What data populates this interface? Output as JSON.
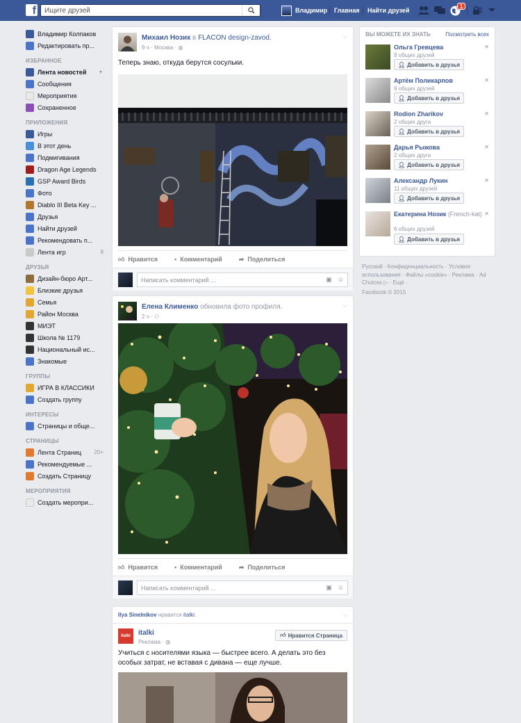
{
  "topbar": {
    "search_placeholder": "Ищите друзей",
    "user_name": "Владимир",
    "home": "Главная",
    "find_friends": "Найти друзей",
    "notifications_count": "1"
  },
  "sidebar": {
    "profile": [
      {
        "label": "Владимир Колпаков",
        "icon": "avatar",
        "color": "#3b5998"
      },
      {
        "label": "Редактировать пр...",
        "icon": "pencil-icon",
        "color": "#4a73c9"
      }
    ],
    "favorites_header": "ИЗБРАННОЕ",
    "favorites": [
      {
        "label": "Лента новостей",
        "icon": "news-feed-icon",
        "color": "#3b5998"
      },
      {
        "label": "Сообщения",
        "icon": "messages-icon",
        "color": "#4a73c9"
      },
      {
        "label": "Мероприятия",
        "icon": "calendar-icon",
        "color": "#e9e9e9"
      },
      {
        "label": "Сохраненное",
        "icon": "bookmark-icon",
        "color": "#8b4fb8"
      }
    ],
    "apps_header": "ПРИЛОЖЕНИЯ",
    "apps": [
      {
        "label": "Игры",
        "icon": "games-icon",
        "color": "#3b5998"
      },
      {
        "label": "В этот день",
        "icon": "clock-icon",
        "color": "#4a90d9"
      },
      {
        "label": "Подмигивания",
        "icon": "poke-icon",
        "color": "#4a73c9"
      },
      {
        "label": "Dragon Age Legends",
        "icon": "dragon-age-icon",
        "color": "#a11c1c"
      },
      {
        "label": "GSP Award Birds",
        "icon": "gsp-birds-icon",
        "color": "#2a6fb2"
      },
      {
        "label": "Фото",
        "icon": "photos-icon",
        "color": "#4a73c9"
      },
      {
        "label": "Diablo III Beta Key ...",
        "icon": "diablo-icon",
        "color": "#b0762c"
      },
      {
        "label": "Друзья",
        "icon": "friends-icon",
        "color": "#4a73c9"
      },
      {
        "label": "Найти друзей",
        "icon": "find-friends-icon",
        "color": "#4a73c9"
      },
      {
        "label": "Рекомендовать п...",
        "icon": "suggest-icon",
        "color": "#4a73c9"
      },
      {
        "label": "Лента игр",
        "icon": "game-feed-icon",
        "color": "#c9c9c9",
        "count": "8"
      }
    ],
    "friends_header": "ДРУЗЬЯ",
    "friends": [
      {
        "label": "Дизайн-бюро Арт...",
        "icon": "briefcase-icon",
        "color": "#8a6d3b"
      },
      {
        "label": "Близкие друзья",
        "icon": "star-icon",
        "color": "#f5c33b"
      },
      {
        "label": "Семья",
        "icon": "home-icon",
        "color": "#e0a82e"
      },
      {
        "label": "Район Москва",
        "icon": "home-icon",
        "color": "#e0a82e"
      },
      {
        "label": "МИЭТ",
        "icon": "graduation-icon",
        "color": "#333333"
      },
      {
        "label": "Школа № 1179",
        "icon": "graduation-icon",
        "color": "#333333"
      },
      {
        "label": "Национальный ис...",
        "icon": "graduation-icon",
        "color": "#333333"
      },
      {
        "label": "Знакомые",
        "icon": "acquaintances-icon",
        "color": "#4a73c9"
      }
    ],
    "groups_header": "ГРУППЫ",
    "groups": [
      {
        "label": "ИГРА В КЛАССИКИ",
        "icon": "group-house-icon",
        "color": "#e0a82e"
      },
      {
        "label": "Создать группу",
        "icon": "plus-icon",
        "color": "#4a73c9"
      }
    ],
    "interests_header": "ИНТЕРЕСЫ",
    "interests": [
      {
        "label": "Страницы и обще...",
        "icon": "pages-list-icon",
        "color": "#4a73c9"
      }
    ],
    "pages_header": "СТРАНИЦЫ",
    "pages": [
      {
        "label": "Лента Страниц",
        "icon": "flag-icon",
        "color": "#e07a2e",
        "count": "20+"
      },
      {
        "label": "Рекомендуемые ...",
        "icon": "thumb-up-icon",
        "color": "#4a73c9"
      },
      {
        "label": "Создать Страницу",
        "icon": "plus-icon",
        "color": "#e07a2e"
      }
    ],
    "events_header": "МЕРОПРИЯТИЯ",
    "events": [
      {
        "label": "Создать меропри...",
        "icon": "calendar-plus-icon",
        "color": "#e9e9e9"
      }
    ]
  },
  "post1": {
    "author": "Михаил Нозик",
    "in_word": "в",
    "place": "FLACON design-zavod.",
    "meta": "9 ч · Москва ·",
    "text": "Теперь знаю, откуда берутся сосульки.",
    "like": "Нравится",
    "comment": "Комментарий",
    "share": "Поделиться",
    "comment_placeholder": "Написать комментарий ..."
  },
  "post2": {
    "author": "Елена Клименко",
    "action": "обновила фото профиля.",
    "meta": "2 ч ·",
    "like": "Нравится",
    "comment": "Комментарий",
    "share": "Поделиться",
    "comment_placeholder": "Написать комментарий ..."
  },
  "post3": {
    "liker": "Ilya Sinelnikov",
    "liked_text": "нравится",
    "liked_page": "italki.",
    "page_name": "italki",
    "ad_label": "Реклама ·",
    "like_page_button": "Нравится Страница",
    "text": "Учиться с носителями языка — быстрее всего. А делать это без особых затрат, не вставая с дивана — еще лучше.",
    "logo_text": "italki"
  },
  "pymk": {
    "title": "ВЫ МОЖЕТЕ ИХ ЗНАТЬ",
    "see_all": "Посмотреть всех",
    "add_label": "Добавить в друзья",
    "people": [
      {
        "name": "Ольга Гревцева",
        "sub": "",
        "mutual": "8 общих друзей"
      },
      {
        "name": "Артём Поликарпов",
        "sub": "",
        "mutual": "9 общих друзей"
      },
      {
        "name": "Rodion Zharikov",
        "sub": "",
        "mutual": "2 общих друга"
      },
      {
        "name": "Дарья Рыжова",
        "sub": "",
        "mutual": "2 общих друга"
      },
      {
        "name": "Александр Лукин",
        "sub": "",
        "mutual": "11 общих друзей"
      },
      {
        "name": "Екатерина Нозик",
        "sub": "(French-kat)",
        "mutual": "6 общих друзей"
      }
    ]
  },
  "footer": {
    "links": "Русский · Конфиденциальность · Условия использования · Файлы «cookie» · Реклама · Ad Choices ▷ · Ещё ·",
    "copyright": "Facebook © 2015"
  },
  "colors": {
    "brand": "#3b5998",
    "background": "#e9ebee",
    "badge": "#f03d25"
  }
}
